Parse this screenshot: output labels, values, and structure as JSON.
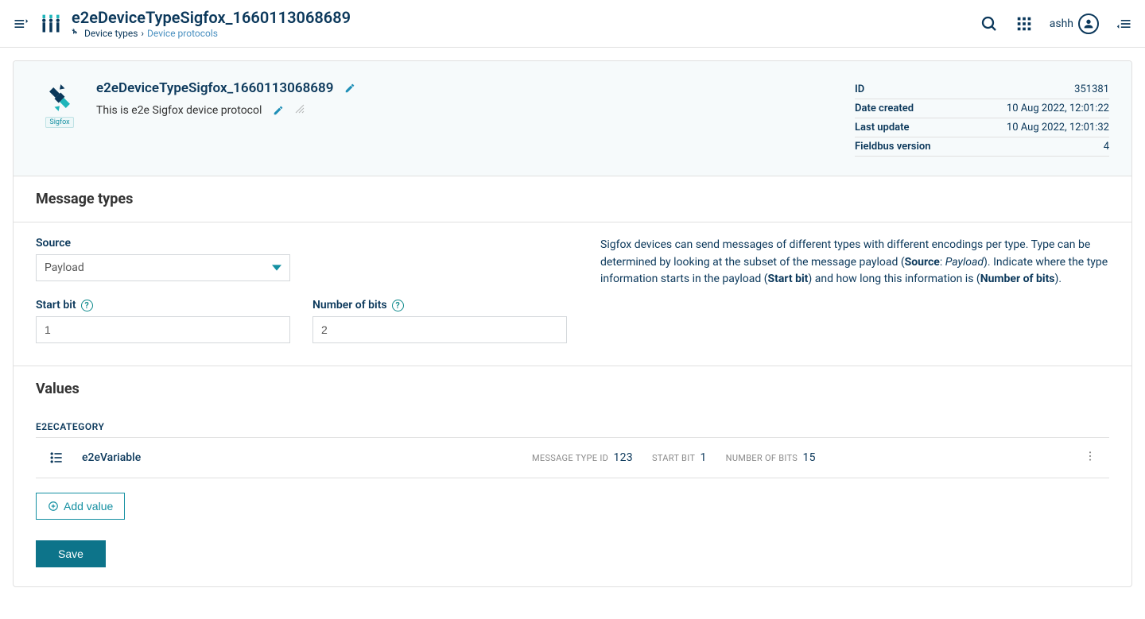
{
  "topbar": {
    "title": "e2eDeviceTypeSigfox_1660113068689",
    "breadcrumb": {
      "root": "Device types",
      "current": "Device protocols"
    },
    "user": "ashh"
  },
  "header": {
    "title": "e2eDeviceTypeSigfox_1660113068689",
    "description": "This is e2e Sigfox device protocol",
    "sigfox_label": "Sigfox",
    "meta": {
      "id_label": "ID",
      "id": "351381",
      "created_label": "Date created",
      "created": "10 Aug 2022, 12:01:22",
      "updated_label": "Last update",
      "updated": "10 Aug 2022, 12:01:32",
      "fbver_label": "Fieldbus version",
      "fbver": "4"
    }
  },
  "sections": {
    "message_types": {
      "title": "Message types",
      "source_label": "Source",
      "source_value": "Payload",
      "startbit_label": "Start bit",
      "startbit_value": "1",
      "numbits_label": "Number of bits",
      "numbits_value": "2",
      "help_pre": "Sigfox devices can send messages of different types with different encodings per type. Type can be determined by looking at the subset of the message payload (",
      "help_src_bold": "Source",
      "help_colon_space": ": ",
      "help_payload_italic": "Payload",
      "help_mid": "). Indicate where the type information starts in the payload (",
      "help_startbit_bold": "Start bit",
      "help_mid2": ") and how long this information is (",
      "help_numbits_bold": "Number of bits",
      "help_end": ")."
    },
    "values": {
      "title": "Values",
      "category": "E2ECATEGORY",
      "row": {
        "name": "e2eVariable",
        "msgtype_label": "MESSAGE TYPE ID",
        "msgtype": "123",
        "startbit_label": "START BIT",
        "startbit": "1",
        "numbits_label": "NUMBER OF BITS",
        "numbits": "15"
      },
      "add_label": "Add value"
    }
  },
  "buttons": {
    "save": "Save"
  }
}
